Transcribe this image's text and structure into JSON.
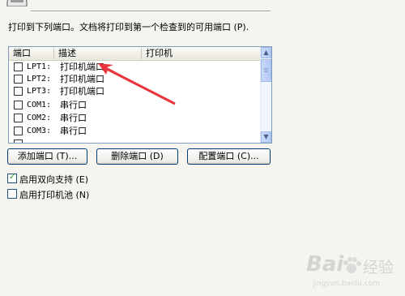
{
  "description": "打印到下列端口。文档将打印到第一个检查到的可用端口 (P).",
  "port_list": {
    "columns": [
      "端口",
      "描述",
      "打印机"
    ],
    "rows": [
      {
        "port": "LPT1:",
        "description": "打印机端口",
        "printer": "",
        "checked": false
      },
      {
        "port": "LPT2:",
        "description": "打印机端口",
        "printer": "",
        "checked": false
      },
      {
        "port": "LPT3:",
        "description": "打印机端口",
        "printer": "",
        "checked": false
      },
      {
        "port": "COM1:",
        "description": "串行口",
        "printer": "",
        "checked": false
      },
      {
        "port": "COM2:",
        "description": "串行口",
        "printer": "",
        "checked": false
      },
      {
        "port": "COM3:",
        "description": "串行口",
        "printer": "",
        "checked": false
      }
    ]
  },
  "buttons": {
    "add_port": "添加端口 (T)...",
    "delete_port": "删除端口 (D)",
    "configure_port": "配置端口 (C)..."
  },
  "options": {
    "bidirectional": {
      "label": "启用双向支持 (E)",
      "checked": true
    },
    "pooling": {
      "label": "启用打印机池 (N)",
      "checked": false
    }
  },
  "watermark": {
    "brand": "Bai",
    "brand_cn": "经验",
    "url": "jingyan.baidu.com"
  },
  "colors": {
    "arrow": "#e8343a",
    "window_bg": "#f5f4ee",
    "list_border": "#7f9db9",
    "button_border": "#003c74"
  }
}
